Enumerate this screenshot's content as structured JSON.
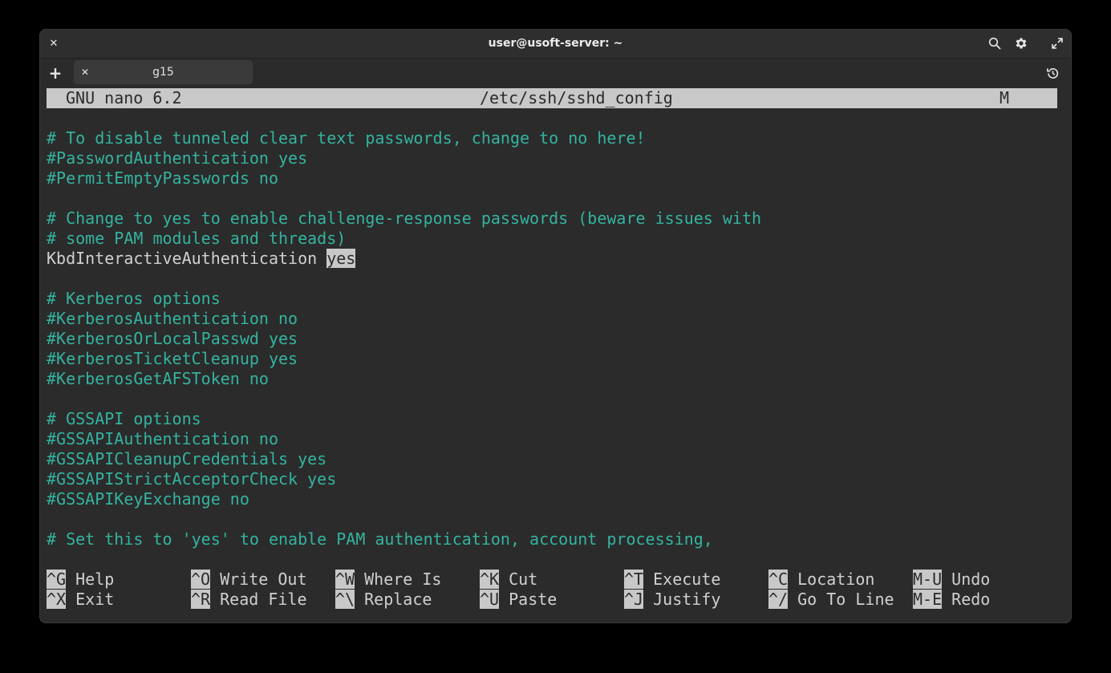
{
  "window": {
    "title": "user@usoft-server: ~",
    "close_glyph": "✕"
  },
  "tabs": {
    "add_glyph": "+",
    "items": [
      {
        "label": "g15",
        "close_glyph": "✕"
      }
    ]
  },
  "nano": {
    "version": "GNU nano 6.2",
    "filename": "/etc/ssh/sshd_config",
    "modified_flag": "M",
    "lines": [
      {
        "text": "# To disable tunneled clear text passwords, change to no here!",
        "kind": "comment"
      },
      {
        "text": "#PasswordAuthentication yes",
        "kind": "comment"
      },
      {
        "text": "#PermitEmptyPasswords no",
        "kind": "comment"
      },
      {
        "text": "",
        "kind": "blank"
      },
      {
        "text": "# Change to yes to enable challenge-response passwords (beware issues with",
        "kind": "comment"
      },
      {
        "text": "# some PAM modules and threads)",
        "kind": "comment"
      },
      {
        "text": "KbdInteractiveAuthentication ",
        "kind": "plain",
        "highlight": "yes"
      },
      {
        "text": "",
        "kind": "blank"
      },
      {
        "text": "# Kerberos options",
        "kind": "comment"
      },
      {
        "text": "#KerberosAuthentication no",
        "kind": "comment"
      },
      {
        "text": "#KerberosOrLocalPasswd yes",
        "kind": "comment"
      },
      {
        "text": "#KerberosTicketCleanup yes",
        "kind": "comment"
      },
      {
        "text": "#KerberosGetAFSToken no",
        "kind": "comment"
      },
      {
        "text": "",
        "kind": "blank"
      },
      {
        "text": "# GSSAPI options",
        "kind": "comment"
      },
      {
        "text": "#GSSAPIAuthentication no",
        "kind": "comment"
      },
      {
        "text": "#GSSAPICleanupCredentials yes",
        "kind": "comment"
      },
      {
        "text": "#GSSAPIStrictAcceptorCheck yes",
        "kind": "comment"
      },
      {
        "text": "#GSSAPIKeyExchange no",
        "kind": "comment"
      },
      {
        "text": "",
        "kind": "blank"
      },
      {
        "text": "# Set this to 'yes' to enable PAM authentication, account processing,",
        "kind": "comment"
      }
    ],
    "shortcuts": [
      [
        {
          "key": "^G",
          "label": "Help"
        },
        {
          "key": "^O",
          "label": "Write Out"
        },
        {
          "key": "^W",
          "label": "Where Is"
        },
        {
          "key": "^K",
          "label": "Cut"
        },
        {
          "key": "^T",
          "label": "Execute"
        },
        {
          "key": "^C",
          "label": "Location"
        },
        {
          "key": "M-U",
          "label": "Undo"
        }
      ],
      [
        {
          "key": "^X",
          "label": "Exit"
        },
        {
          "key": "^R",
          "label": "Read File"
        },
        {
          "key": "^\\",
          "label": "Replace"
        },
        {
          "key": "^U",
          "label": "Paste"
        },
        {
          "key": "^J",
          "label": "Justify"
        },
        {
          "key": "^/",
          "label": "Go To Line"
        },
        {
          "key": "M-E",
          "label": "Redo"
        }
      ]
    ]
  },
  "colors": {
    "comment": "#34b3a0",
    "text": "#d0d0d0",
    "inverse_bg": "#c8c8c8",
    "background": "#2b2b2b"
  }
}
